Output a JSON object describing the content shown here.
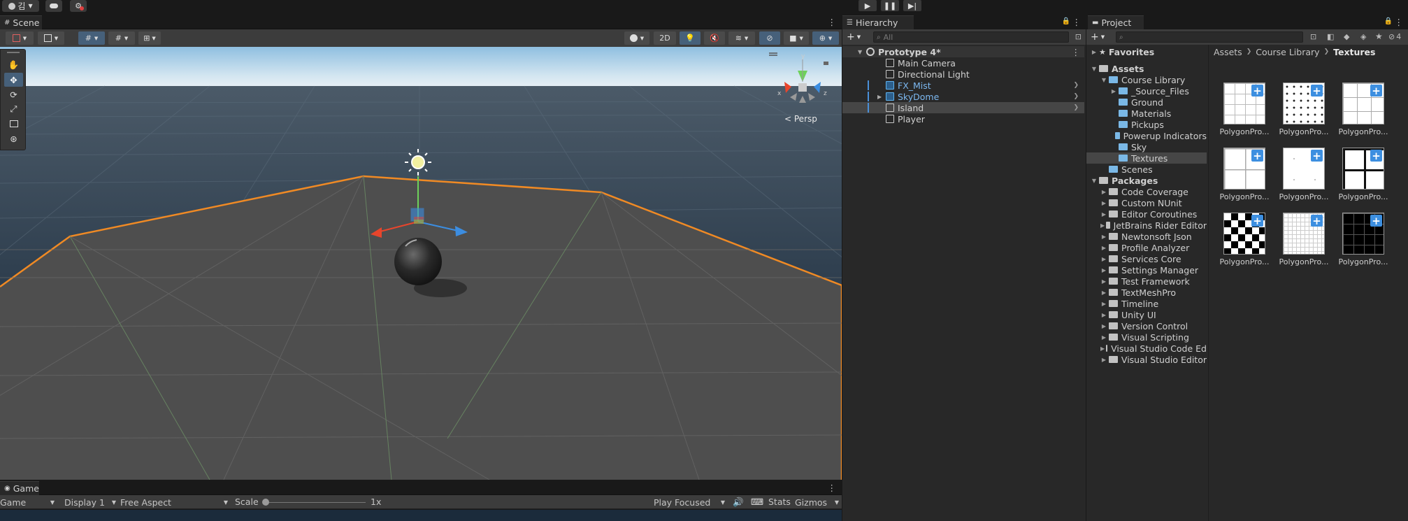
{
  "top_bar": {
    "account_label": "김",
    "play_icons": [
      "play-icon",
      "pause-icon",
      "step-icon"
    ]
  },
  "scene_tab": {
    "title": "Scene",
    "toolbar": {
      "btn_2d": "2D"
    },
    "persp_label": "Persp",
    "gizmo_axes": {
      "x": "x",
      "y": "y",
      "z": "z"
    }
  },
  "game_tab": {
    "title": "Game",
    "toolbar": {
      "view_select": "Game",
      "display_select": "Display 1",
      "aspect_select": "Free Aspect",
      "scale_label": "Scale",
      "scale_value": "1x",
      "play_mode": "Play Focused",
      "stats": "Stats",
      "gizmos": "Gizmos"
    }
  },
  "hierarchy": {
    "title": "Hierarchy",
    "search_placeholder": "All",
    "scene_name": "Prototype 4*",
    "items": [
      {
        "label": "Main Camera",
        "prefab": false,
        "expandable": false,
        "arrow": false
      },
      {
        "label": "Directional Light",
        "prefab": false,
        "expandable": false,
        "arrow": false
      },
      {
        "label": "FX_Mist",
        "prefab": true,
        "expandable": false,
        "arrow": true
      },
      {
        "label": "SkyDome",
        "prefab": true,
        "expandable": true,
        "arrow": true
      },
      {
        "label": "Island",
        "prefab": false,
        "expandable": false,
        "arrow": true,
        "selected": true
      },
      {
        "label": "Player",
        "prefab": false,
        "expandable": false,
        "arrow": false
      }
    ]
  },
  "project": {
    "title": "Project",
    "hidden_count": "4",
    "favorites_label": "Favorites",
    "breadcrumb": [
      "Assets",
      "Course Library",
      "Textures"
    ],
    "tree": [
      {
        "label": "Assets",
        "level": 0,
        "bold": true,
        "open": true
      },
      {
        "label": "Course Library",
        "level": 1,
        "open": true
      },
      {
        "label": "_Source_Files",
        "level": 2,
        "collapsed": true
      },
      {
        "label": "Ground",
        "level": 2
      },
      {
        "label": "Materials",
        "level": 2
      },
      {
        "label": "Pickups",
        "level": 2
      },
      {
        "label": "Powerup Indicators",
        "level": 2
      },
      {
        "label": "Sky",
        "level": 2
      },
      {
        "label": "Textures",
        "level": 2,
        "selected": true
      },
      {
        "label": "Scenes",
        "level": 1
      },
      {
        "label": "Packages",
        "level": 0,
        "bold": true,
        "open": true
      },
      {
        "label": "Code Coverage",
        "level": 1,
        "collapsed": true
      },
      {
        "label": "Custom NUnit",
        "level": 1,
        "collapsed": true
      },
      {
        "label": "Editor Coroutines",
        "level": 1,
        "collapsed": true
      },
      {
        "label": "JetBrains Rider Editor",
        "level": 1,
        "collapsed": true
      },
      {
        "label": "Newtonsoft Json",
        "level": 1,
        "collapsed": true
      },
      {
        "label": "Profile Analyzer",
        "level": 1,
        "collapsed": true
      },
      {
        "label": "Services Core",
        "level": 1,
        "collapsed": true
      },
      {
        "label": "Settings Manager",
        "level": 1,
        "collapsed": true
      },
      {
        "label": "Test Framework",
        "level": 1,
        "collapsed": true
      },
      {
        "label": "TextMeshPro",
        "level": 1,
        "collapsed": true
      },
      {
        "label": "Timeline",
        "level": 1,
        "collapsed": true
      },
      {
        "label": "Unity UI",
        "level": 1,
        "collapsed": true
      },
      {
        "label": "Version Control",
        "level": 1,
        "collapsed": true
      },
      {
        "label": "Visual Scripting",
        "level": 1,
        "collapsed": true
      },
      {
        "label": "Visual Studio Code Ed",
        "level": 1,
        "collapsed": true
      },
      {
        "label": "Visual Studio Editor",
        "level": 1,
        "collapsed": true
      }
    ],
    "assets": [
      {
        "label": "PolygonPro...",
        "pattern": "grid-large"
      },
      {
        "label": "PolygonPro...",
        "pattern": "dotted-grid"
      },
      {
        "label": "PolygonPro...",
        "pattern": "grid-offset"
      },
      {
        "label": "PolygonPro...",
        "pattern": "quad-light"
      },
      {
        "label": "PolygonPro...",
        "pattern": "crosses"
      },
      {
        "label": "PolygonPro...",
        "pattern": "quad-dark"
      },
      {
        "label": "PolygonPro...",
        "pattern": "checker"
      },
      {
        "label": "PolygonPro...",
        "pattern": "fine-grid"
      },
      {
        "label": "PolygonPro...",
        "pattern": "black-grid"
      }
    ]
  }
}
